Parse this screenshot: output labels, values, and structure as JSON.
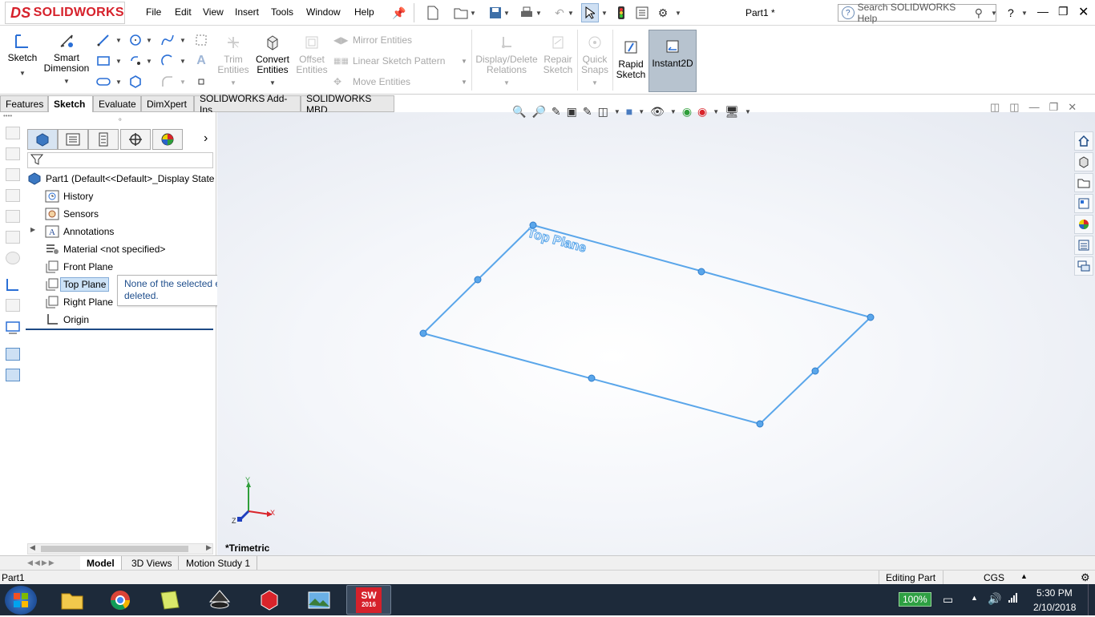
{
  "app": {
    "brand": "SOLIDWORKS",
    "brand_prefix": "DS",
    "document_title": "Part1 *"
  },
  "menu": [
    "File",
    "Edit",
    "View",
    "Insert",
    "Tools",
    "Window",
    "Help"
  ],
  "search": {
    "placeholder": "Search SOLIDWORKS Help"
  },
  "help_label": "?",
  "ribbon": {
    "sketch": "Sketch",
    "smart_dimension": [
      "Smart",
      "Dimension"
    ],
    "trim_entities": [
      "Trim",
      "Entities"
    ],
    "convert_entities": [
      "Convert",
      "Entities"
    ],
    "offset_entities": [
      "Offset",
      "Entities"
    ],
    "mirror_entities": "Mirror Entities",
    "linear_sketch_pattern": "Linear Sketch Pattern",
    "move_entities": "Move Entities",
    "display_delete_relations": [
      "Display/Delete",
      "Relations"
    ],
    "repair_sketch": [
      "Repair",
      "Sketch"
    ],
    "quick_snaps": [
      "Quick",
      "Snaps"
    ],
    "rapid_sketch": [
      "Rapid",
      "Sketch"
    ],
    "instant2d": "Instant2D"
  },
  "command_tabs": [
    "Features",
    "Sketch",
    "Evaluate",
    "DimXpert",
    "SOLIDWORKS Add-Ins",
    "SOLIDWORKS MBD"
  ],
  "active_command_tab": "Sketch",
  "feature_tree": {
    "root": "Part1  (Default<<Default>_Display State",
    "items": [
      "History",
      "Sensors",
      "Annotations",
      "Material <not specified>",
      "Front Plane",
      "Top Plane",
      "Right Plane",
      "Origin"
    ],
    "selected": "Top Plane"
  },
  "tooltip": {
    "text": "None of the selected entities could be deleted."
  },
  "viewport": {
    "plane_label": "Top Plane",
    "view_name": "*Trimetric",
    "triad": {
      "x": "X",
      "y": "Y",
      "z": "Z"
    },
    "sketch_color": "#5aa6ea"
  },
  "bottom_tabs": [
    "Model",
    "3D Views",
    "Motion Study 1"
  ],
  "status": {
    "left": "Part1",
    "mode": "Editing Part",
    "units": "CGS"
  },
  "taskbar": {
    "battery": "100%",
    "time": "5:30 PM",
    "date": "2/10/2018",
    "sw_badge": "2016"
  },
  "colors": {
    "accent": "#d6212b",
    "selection": "#cde3f7",
    "taskbar": "#1d2a3a"
  }
}
